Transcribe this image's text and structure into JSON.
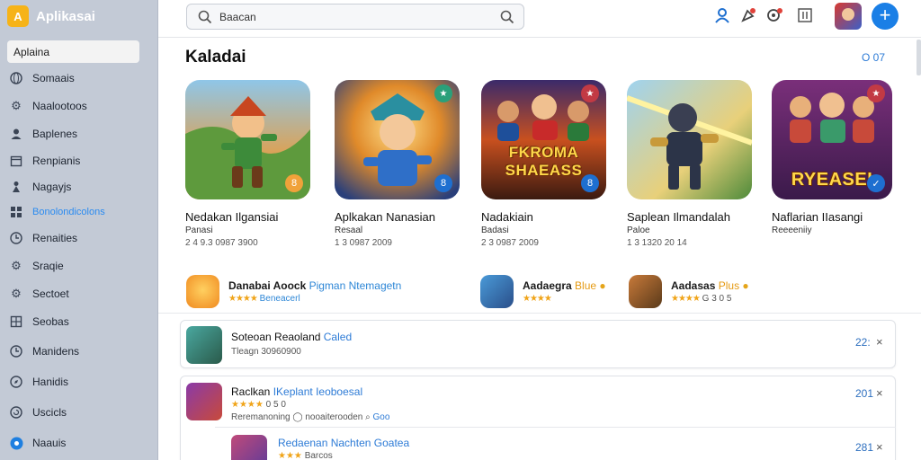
{
  "brand": {
    "logo": "A",
    "name": "Aplikasai"
  },
  "sidebar": {
    "active": "Aplaina",
    "items": [
      {
        "label": "Somaais",
        "icon": "globe-icon"
      },
      {
        "label": "Naalootoos",
        "icon": "gear-icon"
      },
      {
        "label": "Baplenes",
        "icon": "user-icon"
      },
      {
        "label": "Renpianis",
        "icon": "calendar-icon"
      },
      {
        "label": "Nagayjs",
        "icon": "person-icon"
      },
      {
        "label": "Bonolondicolons",
        "icon": "grid-icon"
      },
      {
        "label": "Renaities",
        "icon": "clock-icon"
      },
      {
        "label": "Sraqie",
        "icon": "settings-icon"
      },
      {
        "label": "Sectoet",
        "icon": "cog-icon"
      },
      {
        "label": "Seobas",
        "icon": "table-icon"
      },
      {
        "label": "Manidens",
        "icon": "clock-icon"
      },
      {
        "label": "Hanidis",
        "icon": "compass-icon"
      },
      {
        "label": "Uscicls",
        "icon": "refresh-icon"
      },
      {
        "label": "Naauis",
        "icon": "circle-icon"
      }
    ]
  },
  "search": {
    "placeholder": "Baacan"
  },
  "section": {
    "title": "Kaladai",
    "link": "O 07"
  },
  "cards": [
    {
      "title": "Nedakan Ilgansiai",
      "sub": "Panasi",
      "meta": "2 4 9.3 0987 3900",
      "badge": "8",
      "theme": "forest"
    },
    {
      "title": "Aplkakan Nanasian",
      "sub": "Resaal",
      "meta": "1 3 0987 2009",
      "badge": "8",
      "theme": "knight"
    },
    {
      "title": "Nadakiain",
      "sub": "Badasi",
      "meta": "2 3 0987 2009",
      "badge": "8",
      "overlay": "FKROMA SHAEASS",
      "theme": "fire"
    },
    {
      "title": "Saplean Ilmandalah",
      "sub": "Paloe",
      "meta": "1 3 1320 20 14",
      "theme": "warrior"
    },
    {
      "title": "Naflarian IIasangi",
      "sub": "Reeeeniiy",
      "overlay": "RYEASEI",
      "theme": "magenta"
    }
  ],
  "promos": [
    {
      "title": "Danabai Aoock",
      "accent": "Pigman Ntemagetn",
      "stars": "★★★★",
      "meta": "Beneacerl"
    },
    {
      "title": "Aadaegra",
      "gold": "Blue",
      "stars": "★★★★",
      "meta": ""
    },
    {
      "title": "Aadasas",
      "gold": "Plus",
      "stars": "★★★★",
      "meta": "G 3 0 5"
    }
  ],
  "list": [
    {
      "title": "Soteoan Reaoland",
      "accent": "Caled",
      "sub": "Tleagn 30960900",
      "count": "22:",
      "close": "×"
    },
    {
      "title": "Raclkan",
      "accent": "IKeplant Ieoboesal",
      "stars": "★★★★",
      "stars_meta": "0 5 0",
      "sub_a": "Reremanoning",
      "sub_b": "nooaiterooden",
      "sub_c": "Goo",
      "count": "201",
      "close": "×"
    },
    {
      "title": "Redaenan Nachten",
      "accent": "Goatea",
      "stars": "★★★",
      "stars_meta": "Barcos",
      "count": "281",
      "close": "×"
    }
  ]
}
